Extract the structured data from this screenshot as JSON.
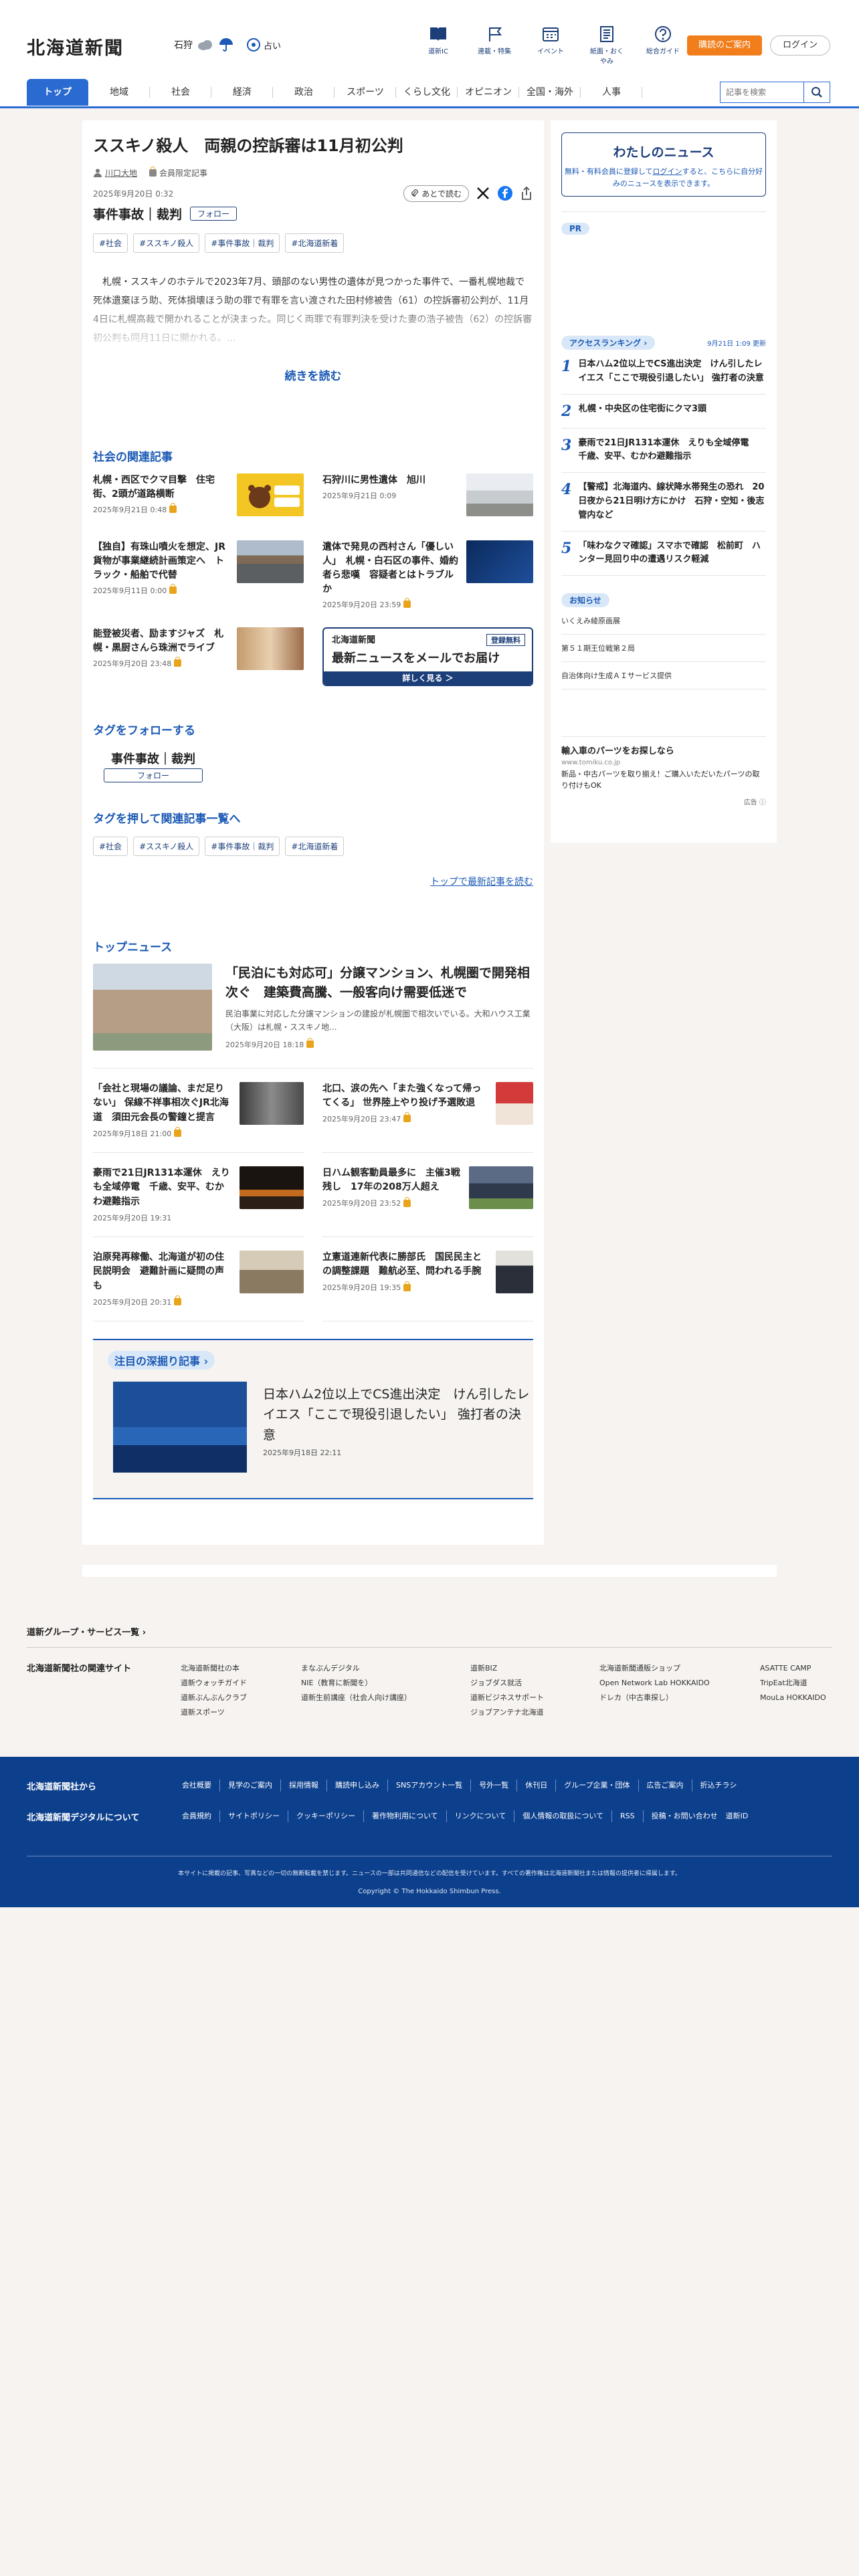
{
  "header": {
    "logo": "北海道新聞",
    "weather_area": "石狩",
    "fortune_label": "占い",
    "icons": [
      {
        "label": "道新IC",
        "icon": "book-icon"
      },
      {
        "label": "連載・特集",
        "icon": "flag-icon"
      },
      {
        "label": "イベント",
        "icon": "calendar-icon"
      },
      {
        "label": "紙面・おくやみ",
        "icon": "newspaper-icon"
      },
      {
        "label": "総合ガイド",
        "icon": "help-icon"
      }
    ],
    "subscribe_label": "購読のご案内",
    "login_label": "ログイン",
    "accent": "#2a6bd1",
    "orange": "#f27d1b"
  },
  "nav": {
    "items": [
      "トップ",
      "地域",
      "社会",
      "経済",
      "政治",
      "スポーツ",
      "くらし文化",
      "オピニオン",
      "全国・海外",
      "人事"
    ],
    "search_placeholder": "記事を検索"
  },
  "article": {
    "title": "ススキノ殺人　両親の控訴審は11月初公判",
    "author": "川口大地",
    "member_label": "会員限定記事",
    "date": "2025年9月20日 0:32",
    "later_label": "あとで読む",
    "topic": "事件事故｜裁判",
    "follow_label": "フォロー",
    "tags": [
      "#社会",
      "#ススキノ殺人",
      "#事件事故｜裁判",
      "#北海道新着"
    ],
    "lead": "札幌・ススキノのホテルで2023年7月、頭部のない男性の遺体が見つかった事件で、一番札幌地裁で死体遺棄ほう助、死体損壊ほう助の罪で有罪を言い渡された田村修被告（61）の控訴審初公判が、11月4日に札幌高裁で開かれることが決まった。同じく両罪で有罪判決を受けた妻の浩子被告（62）の控訴審初公判も同月11日に開かれる。...",
    "read_more": "続きを読む"
  },
  "related": {
    "title": "社会の関連記事",
    "items": [
      {
        "title": "札幌・西区でクマ目撃　住宅街、2頭が道路横断",
        "date": "2025年9月21日 0:48",
        "locked": true,
        "thumb": "bear"
      },
      {
        "title": "石狩川に男性遺体　旭川",
        "date": "2025年9月21日 0:09",
        "locked": false,
        "thumb": "river"
      },
      {
        "title": "【独自】有珠山噴火を想定、JR貨物が事業継続計画策定へ　トラック・船舶で代替",
        "date": "2025年9月11日 0:00",
        "locked": true,
        "thumb": "train"
      },
      {
        "title": "遺体で発見の西村さん「優しい人」　札幌・白石区の事件、婚約者ら悲嘆　容疑者とはトラブルか",
        "date": "2025年9月20日 23:59",
        "locked": true,
        "thumb": "incident"
      },
      {
        "title": "能登被災者、励ますジャズ　札幌・黒厨さんら珠洲でライブ",
        "date": "2025年9月20日 23:48",
        "locked": true,
        "thumb": "jazz"
      }
    ],
    "banner": {
      "brand": "北海道新聞",
      "free": "登録無料",
      "headline": "最新ニュースをメールでお届け",
      "cta": "詳しく見る ＞"
    }
  },
  "follow_section": {
    "title": "タグをフォローする",
    "tag": "事件事故｜裁判",
    "button": "フォロー"
  },
  "tag_search": {
    "title": "タグを押して関連記事一覧へ",
    "tags": [
      "#社会",
      "#ススキノ殺人",
      "#事件事故｜裁判",
      "#北海道新着"
    ],
    "to_top": "トップで最新記事を読む"
  },
  "top_news": {
    "title": "トップニュース",
    "feature": {
      "title": "「民泊にも対応可」分譲マンション、札幌圏で開発相次ぐ　建築費高騰、一般客向け需要低迷で",
      "summary": "民泊事業に対応した分譲マンションの建設が札幌圏で相次いでいる。大和ハウス工業（大阪）は札幌・ススキノ地...",
      "date": "2025年9月20日 18:18",
      "locked": true
    },
    "items": [
      {
        "title": "「会社と現場の議論、まだ足りない」 保線不祥事相次ぐJR北海道　須田元会長の警鐘と提言",
        "date": "2025年9月18日 21:00",
        "thumb": "portrait"
      },
      {
        "title": "北口、涙の先へ「また強くなって帰ってくる」 世界陸上やり投げ予選敗退",
        "date": "2025年9月20日 23:47",
        "thumb": "athlete"
      },
      {
        "title": "豪雨で21日JR131本運休　えりも全域停電　千歳、安平、むかわ避難指示",
        "date": "2025年9月20日 19:31",
        "thumb": "night"
      },
      {
        "title": "日ハム観客動員最多に　主催3戦残し　17年の208万人超え",
        "date": "2025年9月20日 23:52",
        "thumb": "stadium"
      },
      {
        "title": "泊原発再稼働、北海道が初の住民説明会　避難計画に疑問の声も",
        "date": "2025年9月20日 20:31",
        "thumb": "hall"
      },
      {
        "title": "立憲道連新代表に勝部氏　国民民主との調整課題　難航必至、問われる手腕",
        "date": "2025年9月20日 19:35",
        "thumb": "man"
      }
    ]
  },
  "deep_dive": {
    "title": "注目の深掘り記事",
    "headline": "日本ハム2位以上でCS進出決定　けん引したレイエス「ここで現役引退したい」 強打者の決意",
    "date": "2025年9月18日 22:11"
  },
  "sidebar": {
    "my_news_title": "わたしのニュース",
    "my_news_text_1": "無料・有料会員に登録して",
    "my_news_login": "ログイン",
    "my_news_text_2": "すると、こちらに自分好みのニュースを表示できます。",
    "pr_label": "PR",
    "ranking_label": "アクセスランキング",
    "ranking_updated": "9月21日 1:09 更新",
    "ranking": [
      {
        "n": "1",
        "title": "日本ハム2位以上でCS進出決定　けん引したレイエス「ここで現役引退したい」 強打者の決意"
      },
      {
        "n": "2",
        "title": "札幌・中央区の住宅街にクマ3頭"
      },
      {
        "n": "3",
        "title": "豪雨で21日JR131本運休　えりも全域停電　千歳、安平、むかわ避難指示"
      },
      {
        "n": "4",
        "title": "【警戒】北海道内、線状降水帯発生の恐れ　20日夜から21日明け方にかけ　石狩・空知・後志管内など"
      },
      {
        "n": "5",
        "title": "「味わなクマ確認」スマホで確認　松前町　ハンター見回り中の遭遇リスク軽減"
      }
    ],
    "notice_label": "お知らせ",
    "notices": [
      "いくえみ綾原画展",
      "第５１期王位戦第２局",
      "自治体向け生成ＡＩサービス提供"
    ],
    "ad": {
      "headline": "輸入車のパーツをお探しなら",
      "url": "www.tomiku.co.jp",
      "body": "新品・中古パーツを取り揃え！ご購入いただいたパーツの取り付けもOK",
      "mark": "広告"
    }
  },
  "group": {
    "title": "道新グループ・サービス一覧",
    "label": "北海道新聞社の関連サイト",
    "columns": [
      [
        "北海道新聞社の本",
        "道新ウォッチガイド",
        "道新ぶんぶんクラブ",
        "道新スポーツ"
      ],
      [
        "まなぶんデジタル",
        "NIE（教育に新聞を）",
        "道新生前講座（社会人向け講座）"
      ],
      [
        "道新BIZ",
        "ジョブダス就活",
        "道新ビジネスサポート",
        "ジョブアンテナ北海道"
      ],
      [
        "北海道新聞通販ショップ",
        "Open Network Lab HOKKAIDO",
        "ドレカ（中古車探し）"
      ],
      [
        "ASATTE CAMP",
        "TripEat北海道",
        "MouLa HOKKAIDO"
      ]
    ]
  },
  "footer": {
    "row1_label": "北海道新聞社から",
    "row1_links": [
      "会社概要",
      "見学のご案内",
      "採用情報",
      "購読申し込み",
      "SNSアカウント一覧",
      "号外一覧",
      "休刊日",
      "グループ企業・団体",
      "広告ご案内",
      "折込チラシ"
    ],
    "row2_label": "北海道新聞デジタルについて",
    "row2_links": [
      "会員規約",
      "サイトポリシー",
      "クッキーポリシー",
      "著作物利用について",
      "リンクについて",
      "個人情報の取扱について",
      "RSS",
      "投稿・お問い合わせ",
      "道新ID"
    ],
    "note": "本サイトに掲載の記事、写真などの一切の無断転載を禁じます。ニュースの一部は共同通信などの配信を受けています。すべての著作権は北海道新聞社または情報の提供者に帰属します。",
    "copyright": "Copyright © The Hokkaido Shimbun Press."
  }
}
